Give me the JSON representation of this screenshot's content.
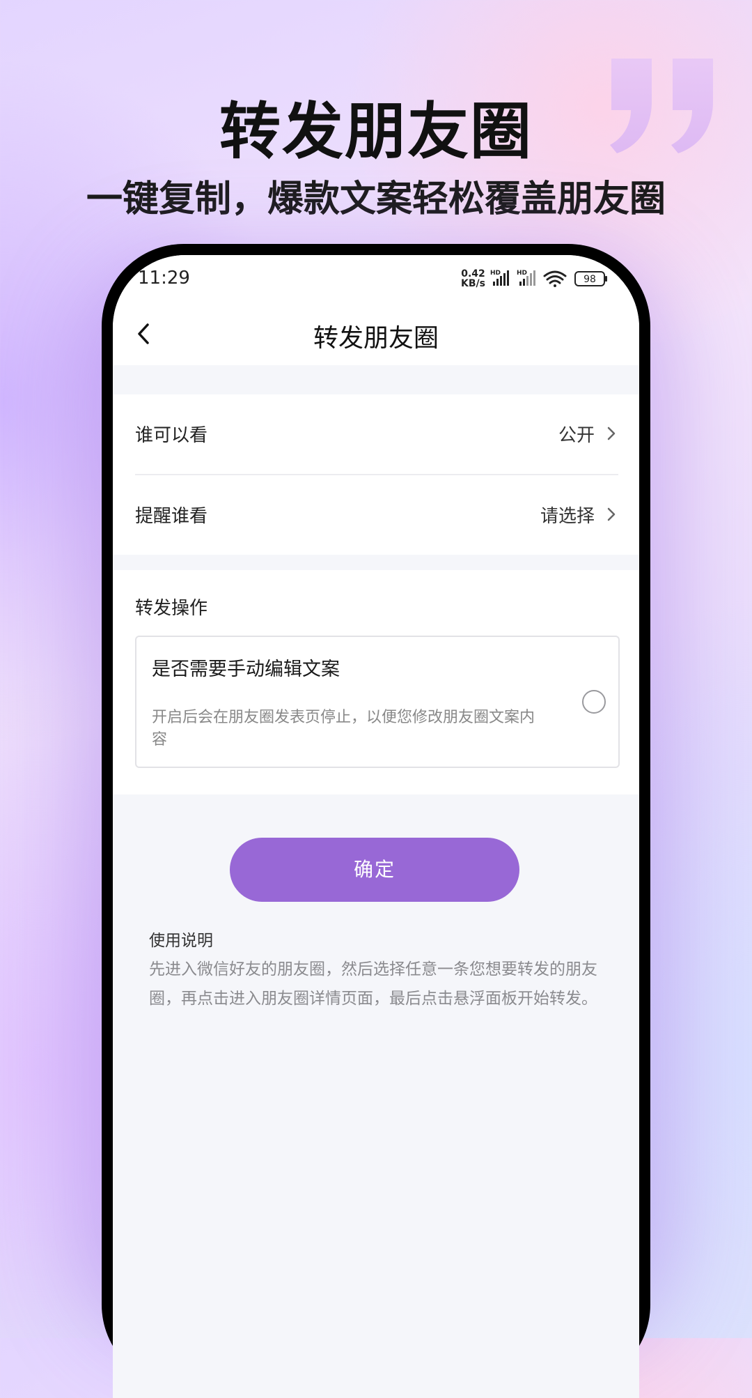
{
  "hero": {
    "title": "转发朋友圈",
    "subtitle": "一键复制，爆款文案轻松覆盖朋友圈"
  },
  "status_bar": {
    "time": "11:29",
    "net_speed": "0.42",
    "net_unit": "KB/s",
    "signal_label": "HD",
    "battery": "98"
  },
  "nav": {
    "title": "转发朋友圈"
  },
  "settings": {
    "rows": [
      {
        "label": "谁可以看",
        "value": "公开"
      },
      {
        "label": "提醒谁看",
        "value": "请选择"
      }
    ]
  },
  "forward_ops": {
    "heading": "转发操作",
    "option": {
      "title": "是否需要手动编辑文案",
      "description": "开启后会在朋友圈发表页停止，以便您修改朋友圈文案内容",
      "checked": false
    }
  },
  "confirm_button": {
    "label": "确定"
  },
  "instructions": {
    "title": "使用说明",
    "body": "先进入微信好友的朋友圈，然后选择任意一条您想要转发的朋友圈，再点击进入朋友圈详情页面，最后点击悬浮面板开始转发。"
  },
  "colors": {
    "accent": "#9868d6",
    "page_bg": "#f5f6fa"
  }
}
